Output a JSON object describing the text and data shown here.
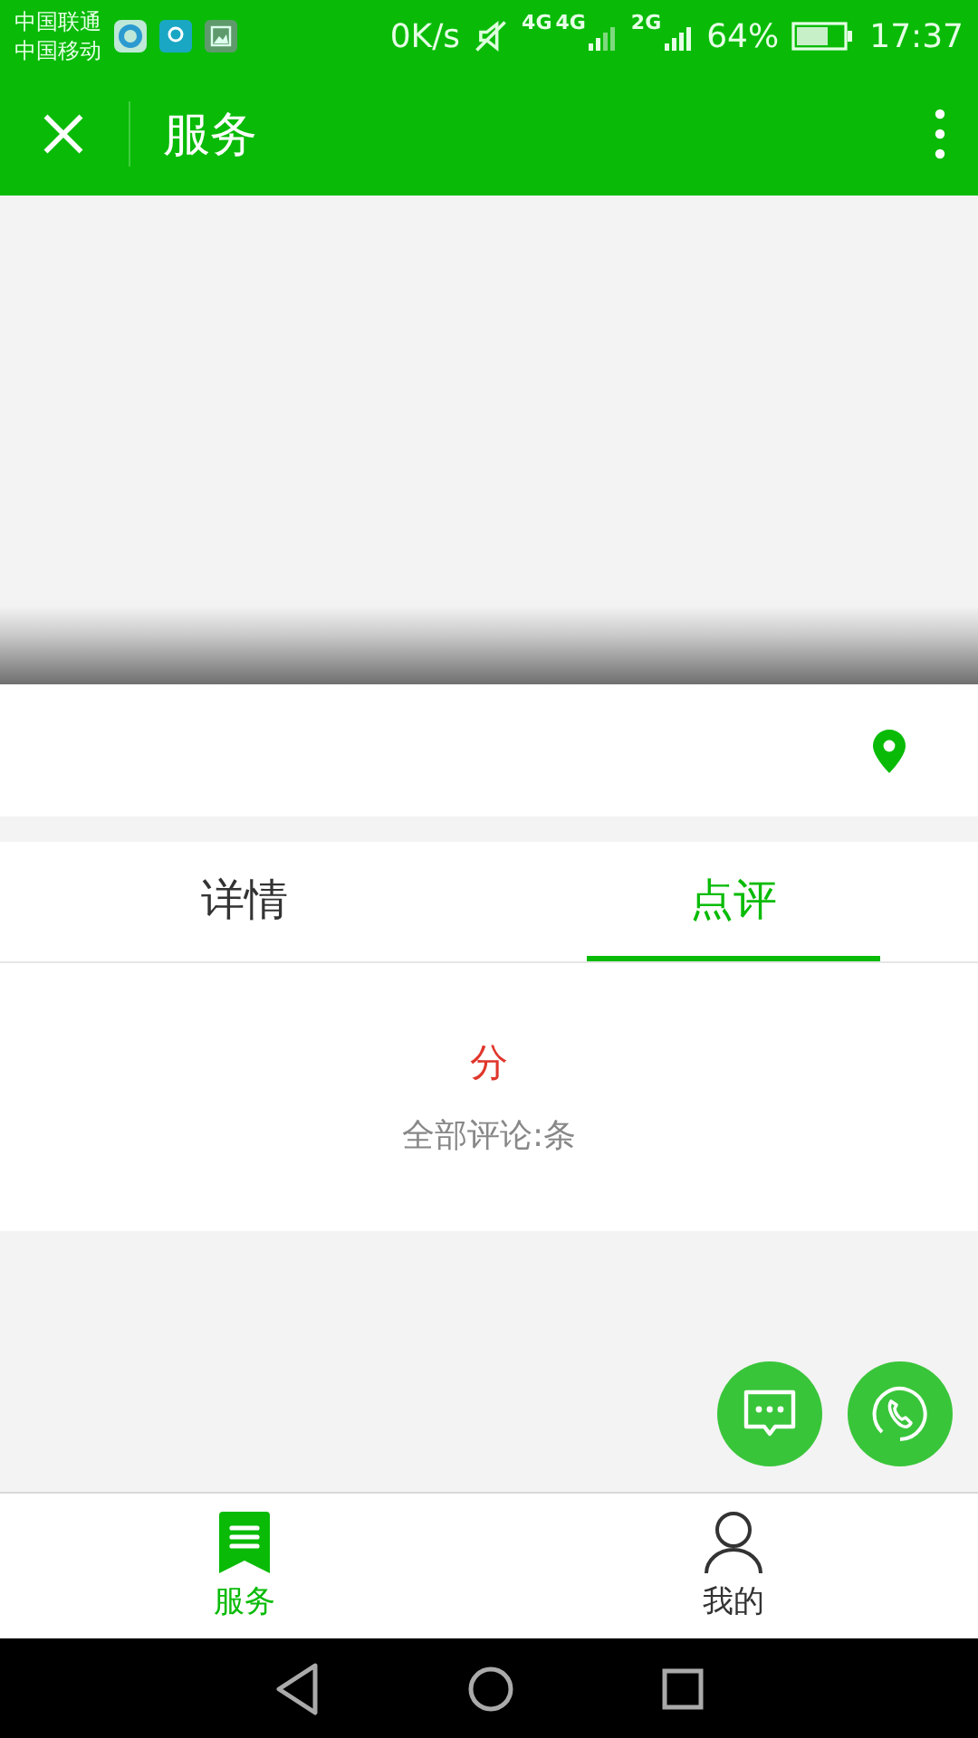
{
  "status_bar": {
    "carriers": [
      "中国联通",
      "中国移动"
    ],
    "speed": "0K/s",
    "networks": [
      "4G",
      "4G",
      "2G"
    ],
    "battery": "64%",
    "time": "17:37"
  },
  "app_bar": {
    "title": "服务"
  },
  "tabs": [
    {
      "label": "详情",
      "selected": false
    },
    {
      "label": "点评",
      "selected": true
    }
  ],
  "rating": {
    "score": "分",
    "count": "全部评论:条"
  },
  "bottom_nav": [
    {
      "label": "服务",
      "kind": "services",
      "selected": true
    },
    {
      "label": "我的",
      "kind": "profile",
      "selected": false
    }
  ]
}
